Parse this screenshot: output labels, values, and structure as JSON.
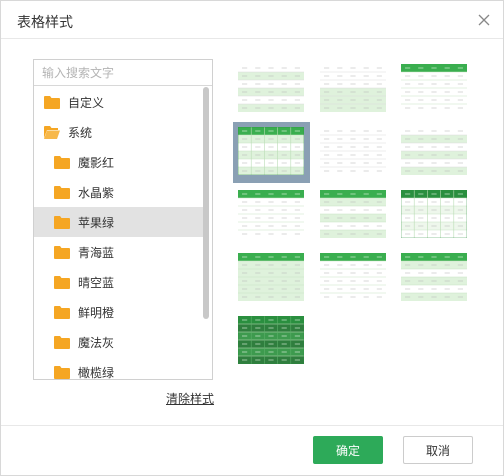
{
  "dialog": {
    "title": "表格样式",
    "close_icon": "close-icon"
  },
  "search": {
    "placeholder": "输入搜索文字",
    "value": ""
  },
  "tree": {
    "items": [
      {
        "label": "自定义",
        "level": 0,
        "icon": "folder-icon",
        "selected": false
      },
      {
        "label": "系统",
        "level": 0,
        "icon": "folder-open-icon",
        "selected": false
      },
      {
        "label": "魔影红",
        "level": 1,
        "icon": "folder-icon",
        "selected": false
      },
      {
        "label": "水晶紫",
        "level": 1,
        "icon": "folder-icon",
        "selected": false
      },
      {
        "label": "苹果绿",
        "level": 1,
        "icon": "folder-icon",
        "selected": true
      },
      {
        "label": "青海蓝",
        "level": 1,
        "icon": "folder-icon",
        "selected": false
      },
      {
        "label": "晴空蓝",
        "level": 1,
        "icon": "folder-icon",
        "selected": false
      },
      {
        "label": "鲜明橙",
        "level": 1,
        "icon": "folder-icon",
        "selected": false
      },
      {
        "label": "魔法灰",
        "level": 1,
        "icon": "folder-icon",
        "selected": false
      },
      {
        "label": "橄榄绿",
        "level": 1,
        "icon": "folder-icon",
        "selected": false
      }
    ]
  },
  "clear_label": "清除样式",
  "styles": {
    "selected_index": 3,
    "items": [
      {
        "name": "style-1",
        "header": "none",
        "bands": "light"
      },
      {
        "name": "style-2",
        "header": "none",
        "bands": "light-block"
      },
      {
        "name": "style-3",
        "header": "green",
        "bands": "plain"
      },
      {
        "name": "style-4",
        "header": "green",
        "bands": "light-grid"
      },
      {
        "name": "style-5",
        "header": "none",
        "bands": "plain-lines"
      },
      {
        "name": "style-6",
        "header": "none",
        "bands": "light"
      },
      {
        "name": "style-7",
        "header": "green",
        "bands": "plain"
      },
      {
        "name": "style-8",
        "header": "green",
        "bands": "light"
      },
      {
        "name": "style-9",
        "header": "darkgreen",
        "bands": "grid"
      },
      {
        "name": "style-10",
        "header": "green",
        "bands": "light-full"
      },
      {
        "name": "style-11",
        "header": "green",
        "bands": "plain-lines"
      },
      {
        "name": "style-12",
        "header": "green",
        "bands": "light-alt"
      },
      {
        "name": "style-13",
        "header": "darkgreen",
        "bands": "dark"
      }
    ]
  },
  "colors": {
    "accent": "#2daa59",
    "header_green": "#3aae4f",
    "dark_green": "#2a8f3f",
    "light_green": "#dff2dc",
    "folder": "#f5a623",
    "selected_bg": "#e2e2e2"
  },
  "footer": {
    "ok_label": "确定",
    "cancel_label": "取消"
  }
}
